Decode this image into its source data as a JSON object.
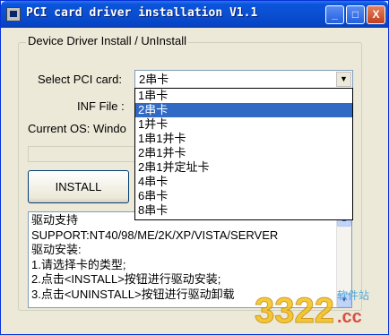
{
  "window": {
    "title": "PCI card driver installation V1.1",
    "buttons": {
      "minimize": "_",
      "maximize": "□",
      "close": "X"
    }
  },
  "group": {
    "legend": "Device Driver Install / UnInstall"
  },
  "form": {
    "select_label": "Select PCI card:",
    "select_value": "2串卡",
    "inf_label": "INF File :",
    "os_label": "Current OS: Windo"
  },
  "dropdown": {
    "options": [
      "1串卡",
      "2串卡",
      "1并卡",
      "1串1并卡",
      "2串1并卡",
      "2串1并定址卡",
      "4串卡",
      "6串卡",
      "8串卡"
    ],
    "selected_index": 1
  },
  "buttons": {
    "install": "INSTALL",
    "uninstall": ""
  },
  "info": {
    "lines": [
      "驱动支持",
      "SUPPORT:NT40/98/ME/2K/XP/VISTA/SERVER",
      "驱动安装:",
      "1.请选择卡的类型;",
      "2.点击<INSTALL>按钮进行驱动安装;",
      "3.点击<UNINSTALL>按钮进行驱动卸载"
    ]
  },
  "watermark": {
    "text": "3322",
    "suffix": ".cc",
    "site": "软件站"
  }
}
